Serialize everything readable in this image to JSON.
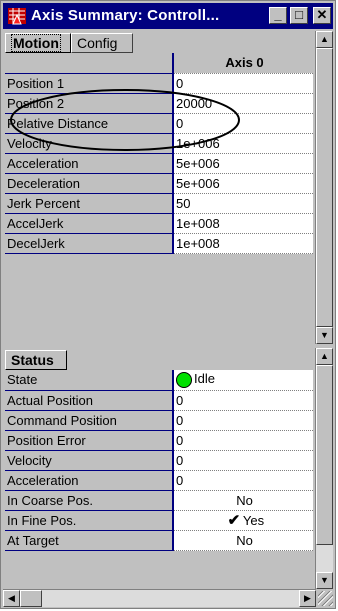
{
  "window": {
    "title": "Axis Summary: Controll...",
    "min_glyph": "_",
    "max_glyph": "□",
    "close_glyph": "✕"
  },
  "motion_panel": {
    "tabs": [
      {
        "label": "Motion"
      },
      {
        "label": "Config"
      }
    ],
    "column_header": "Axis 0",
    "rows": [
      {
        "label": "Position 1",
        "value": "0"
      },
      {
        "label": "Position 2",
        "value": "20000"
      },
      {
        "label": "Relative Distance",
        "value": "0"
      },
      {
        "label": "Velocity",
        "value": "1e+006"
      },
      {
        "label": "Acceleration",
        "value": "5e+006"
      },
      {
        "label": "Deceleration",
        "value": "5e+006"
      },
      {
        "label": "Jerk Percent",
        "value": "50"
      },
      {
        "label": "AccelJerk",
        "value": "1e+008"
      },
      {
        "label": "DecelJerk",
        "value": "1e+008"
      }
    ]
  },
  "status_panel": {
    "tab": "Status",
    "rows": [
      {
        "label": "State",
        "value": "Idle",
        "indicator": "green-dot"
      },
      {
        "label": "Actual Position",
        "value": "0"
      },
      {
        "label": "Command Position",
        "value": "0"
      },
      {
        "label": "Position Error",
        "value": "0"
      },
      {
        "label": "Velocity",
        "value": "0"
      },
      {
        "label": "Acceleration",
        "value": "0"
      },
      {
        "label": "In Coarse Pos.",
        "value": "No"
      },
      {
        "label": "In Fine Pos.",
        "value": "Yes",
        "indicator": "check"
      },
      {
        "label": "At Target",
        "value": "No"
      }
    ]
  },
  "colors": {
    "title_bar": "#000080",
    "indicator_idle": "#00e000",
    "panel": "#c0c0c0"
  },
  "scroll": {
    "up_glyph": "▲",
    "down_glyph": "▼",
    "left_glyph": "◀",
    "right_glyph": "▶"
  }
}
